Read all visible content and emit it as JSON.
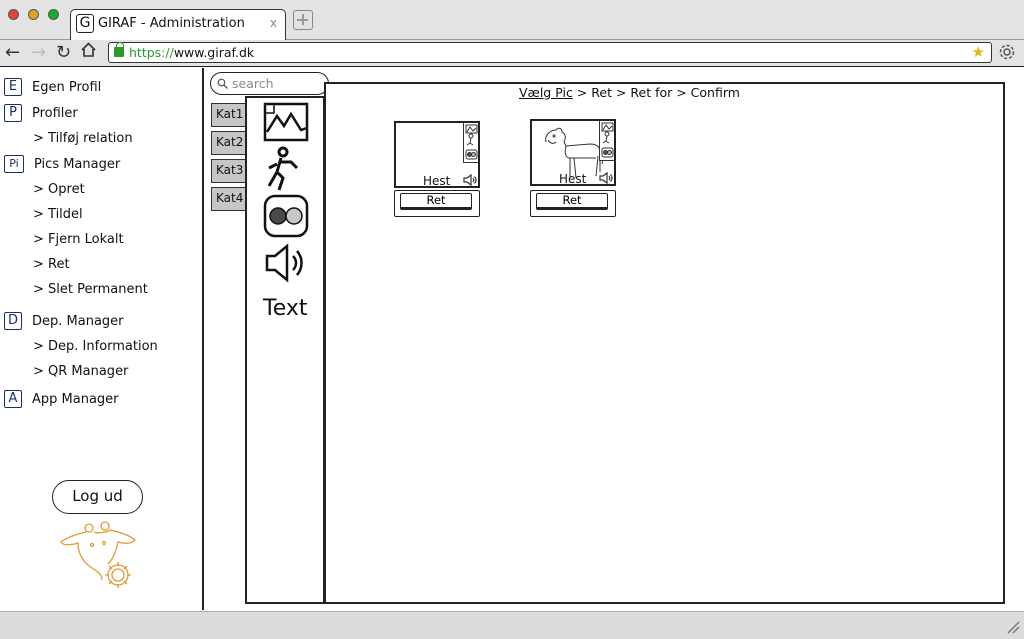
{
  "browser": {
    "tab_title": "GIRAF - Administration",
    "tab_icon_letter": "G",
    "tab_close": "x",
    "url_scheme": "https://",
    "url_rest": "www.giraf.dk"
  },
  "sidebar": {
    "items": [
      {
        "badge": "E",
        "label": "Egen Profil"
      },
      {
        "badge": "P",
        "label": "Profiler"
      },
      {
        "badge": "Pi",
        "label": "Pics Manager"
      },
      {
        "badge": "D",
        "label": "Dep. Manager"
      },
      {
        "badge": "A",
        "label": "App Manager"
      }
    ],
    "sub_items": {
      "profiler": [
        "> Tilføj relation"
      ],
      "pics": [
        "> Opret",
        "> Tildel",
        "> Fjern Lokalt",
        "> Ret",
        "> Slet Permanent"
      ],
      "dep": [
        "> Dep. Information",
        "> QR Manager"
      ]
    },
    "logout_label": "Log ud"
  },
  "search": {
    "placeholder": "search"
  },
  "categories": [
    "Kat1",
    "Kat2",
    "Kat3",
    "Kat4"
  ],
  "tools": {
    "text_label": "Text"
  },
  "breadcrumb": {
    "link": "Vælg Pic",
    "rest": " > Ret > Ret for > Confirm"
  },
  "pictograms": [
    {
      "label": "Hest",
      "button": "Ret",
      "has_image": false
    },
    {
      "label": "Hest",
      "button": "Ret",
      "has_image": true
    }
  ],
  "colors": {
    "badge_border": "#1d2f6b",
    "https_green": "#2a9a2a",
    "logo_orange": "#e39a2e",
    "category_tab_gray": "#c6c6c6"
  }
}
